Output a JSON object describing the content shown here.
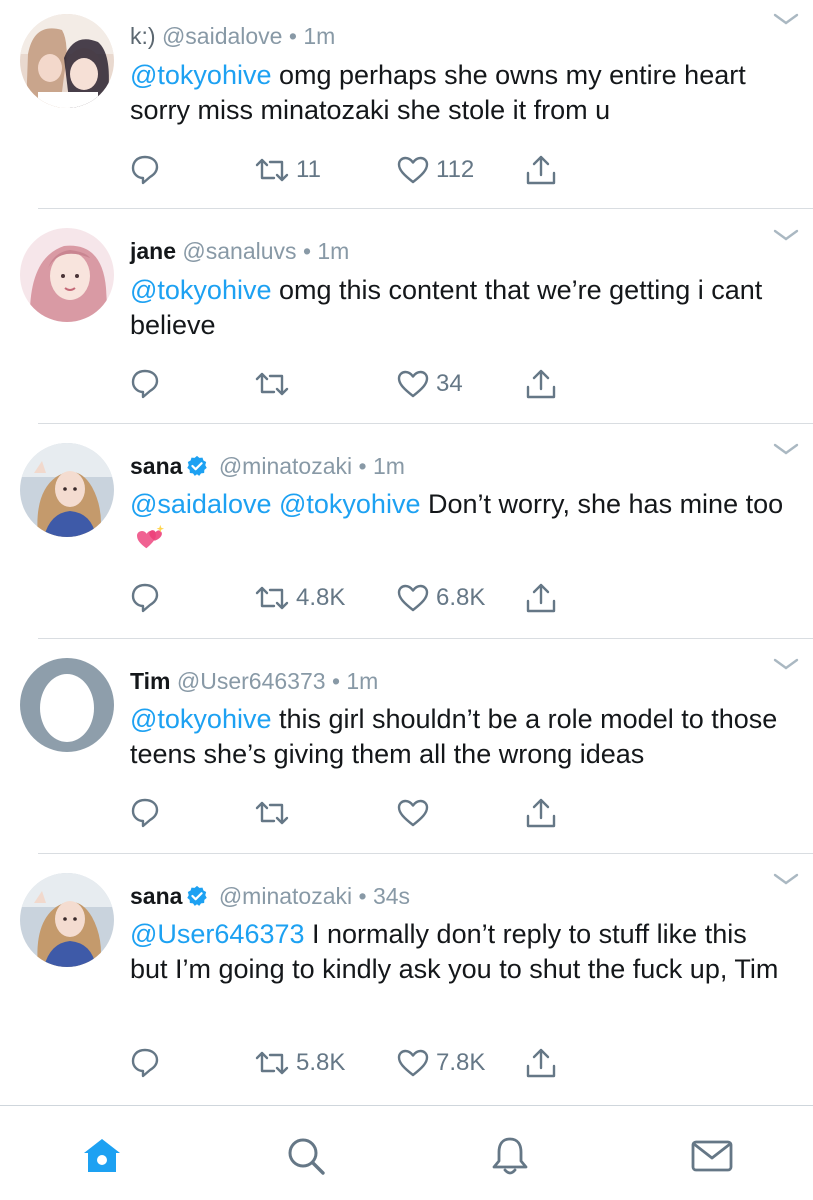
{
  "colors": {
    "accent": "#1da1f2",
    "muted": "#657786",
    "text": "#14171a",
    "divider": "#d9dde1",
    "verified": "#1da1f2"
  },
  "tweets": [
    {
      "display_name": "k:)",
      "handle": "@saidalove",
      "sep": "•",
      "time": "1m",
      "verified": false,
      "body_mentions": "@tokyohive",
      "body_text": " omg perhaps she owns my entire heart sorry miss minatozaki she stole it from u",
      "reply_icon": "reply-icon",
      "retweet_count": "11",
      "like_count": "112"
    },
    {
      "display_name": "jane",
      "handle": "@sanaluvs",
      "sep": "•",
      "time": "1m",
      "verified": false,
      "body_mentions": "@tokyohive",
      "body_text": " omg this content that we’re getting i cant believe",
      "retweet_count": "",
      "like_count": "34"
    },
    {
      "display_name": "sana",
      "handle": "@minatozaki",
      "sep": "•",
      "time": "1m",
      "verified": true,
      "body_mentions": "@saidalove @tokyohive",
      "body_text": " Don’t worry, she has mine too",
      "emoji": "sparkling-heart",
      "retweet_count": "4.8K",
      "like_count": "6.8K"
    },
    {
      "display_name": "Tim",
      "handle": "@User646373",
      "sep": "•",
      "time": "1m",
      "verified": false,
      "body_mentions": "@tokyohive",
      "body_text": " this girl shouldn’t be a role model to those teens she’s giving them all the wrong ideas",
      "retweet_count": "",
      "like_count": ""
    },
    {
      "display_name": "sana",
      "handle": "@minatozaki",
      "sep": "•",
      "time": "34s",
      "verified": true,
      "body_mentions": "@User646373",
      "body_text": " I normally don’t reply to stuff like this but I’m going to kindly ask you to shut the fuck up, Tim",
      "retweet_count": "5.8K",
      "like_count": "7.8K"
    }
  ],
  "tabbar": {
    "items": [
      {
        "name": "home",
        "icon": "home-icon",
        "active": true
      },
      {
        "name": "search",
        "icon": "search-icon",
        "active": false
      },
      {
        "name": "notifications",
        "icon": "bell-icon",
        "active": false
      },
      {
        "name": "messages",
        "icon": "mail-icon",
        "active": false
      }
    ]
  }
}
